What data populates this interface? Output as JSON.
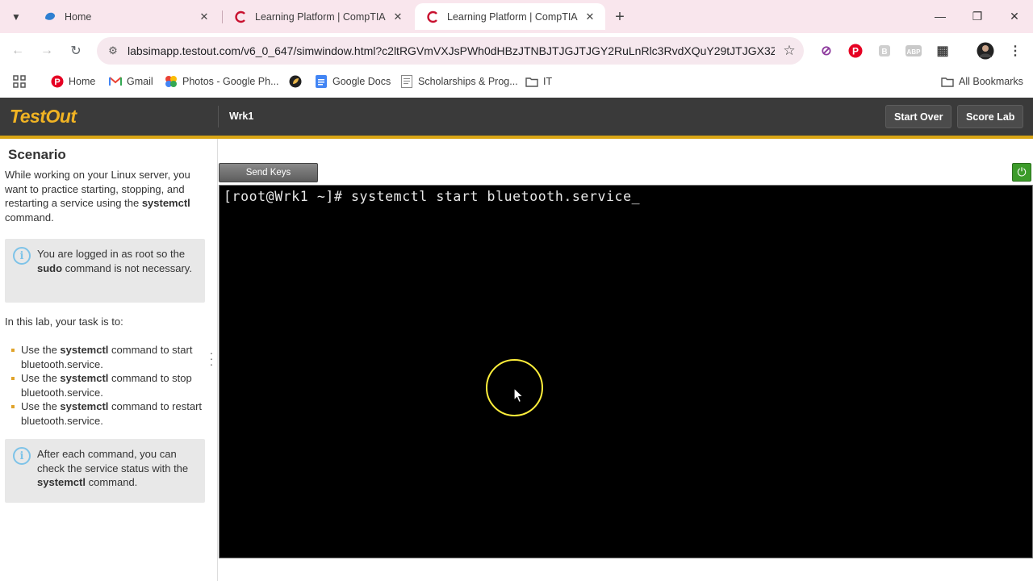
{
  "browser": {
    "tabs": [
      {
        "title": "Home",
        "active": false
      },
      {
        "title": "Learning Platform | CompTIA",
        "active": false
      },
      {
        "title": "Learning Platform | CompTIA",
        "active": true
      }
    ],
    "url": "labsimapp.testout.com/v6_0_647/simwindow.html?c2ltRGVmVXJsPWh0dHBzJTNBJTJGJTJGY2RuLnRlc3RvdXQuY29tJTJGX3ZlcnN...",
    "bookmarks": [
      {
        "label": "Home",
        "icon": "pinterest-icon"
      },
      {
        "label": "Gmail",
        "icon": "gmail-icon"
      },
      {
        "label": "Photos - Google Ph...",
        "icon": "photos-icon"
      },
      {
        "label": "",
        "icon": "leaf-icon"
      },
      {
        "label": "Google Docs",
        "icon": "docs-icon"
      },
      {
        "label": "Scholarships & Prog...",
        "icon": "document-icon"
      },
      {
        "label": "IT",
        "icon": "folder-icon"
      }
    ],
    "all_bookmarks": "All Bookmarks"
  },
  "app": {
    "logo": "TestOut",
    "machine": "Wrk1",
    "start_over": "Start Over",
    "score_lab": "Score Lab",
    "send_keys": "Send Keys",
    "terminal_line": "[root@Wrk1 ~]# systemctl start bluetooth.service_"
  },
  "scenario": {
    "heading": "Scenario",
    "intro_a": "While working on your Linux server, you want to practice starting, stopping, and restarting a service using the ",
    "intro_cmd": "systemctl",
    "intro_b": " command.",
    "note1_a": "You are logged in as root so the ",
    "note1_cmd": "sudo",
    "note1_b": " command is not necessary.",
    "task_intro": "In this lab, your task is to:",
    "tasks": [
      {
        "a": "Use the ",
        "cmd": "systemctl",
        "b": " command to start bluetooth.service."
      },
      {
        "a": "Use the ",
        "cmd": "systemctl",
        "b": " command to stop bluetooth.service."
      },
      {
        "a": "Use the ",
        "cmd": "systemctl",
        "b": " command to restart bluetooth.service."
      }
    ],
    "note2_a": "After each command, you can check the service status with the ",
    "note2_cmd": "systemctl",
    "note2_b": " command."
  },
  "colors": {
    "logo": "#f0b323",
    "header_bg": "#3a3a3a",
    "accent_bar": "#d9a514",
    "terminal_bg": "#000000",
    "power_button": "#3c9b2a",
    "cursor_highlight": "#ffef3b"
  }
}
